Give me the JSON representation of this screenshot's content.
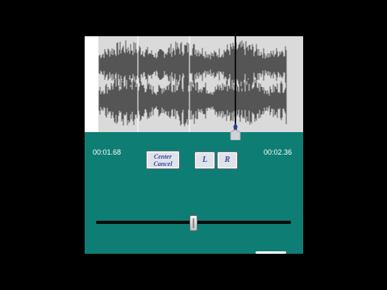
{
  "player": {
    "current_time": "00:01.68",
    "end_time": "00:02.36"
  },
  "buttons": {
    "center_cancel_line1": "Center",
    "center_cancel_line2": "Cancel",
    "left_label": "L",
    "right_label": "R"
  },
  "slider": {
    "value_fraction": 0.5
  },
  "colors": {
    "panel_bg": "#0e7d74",
    "waveform": "#555555",
    "waveform_bg": "#dadada",
    "button_text": "#3c4aa0"
  },
  "icons": {
    "playhead_handle": "playhead-marker-icon"
  }
}
